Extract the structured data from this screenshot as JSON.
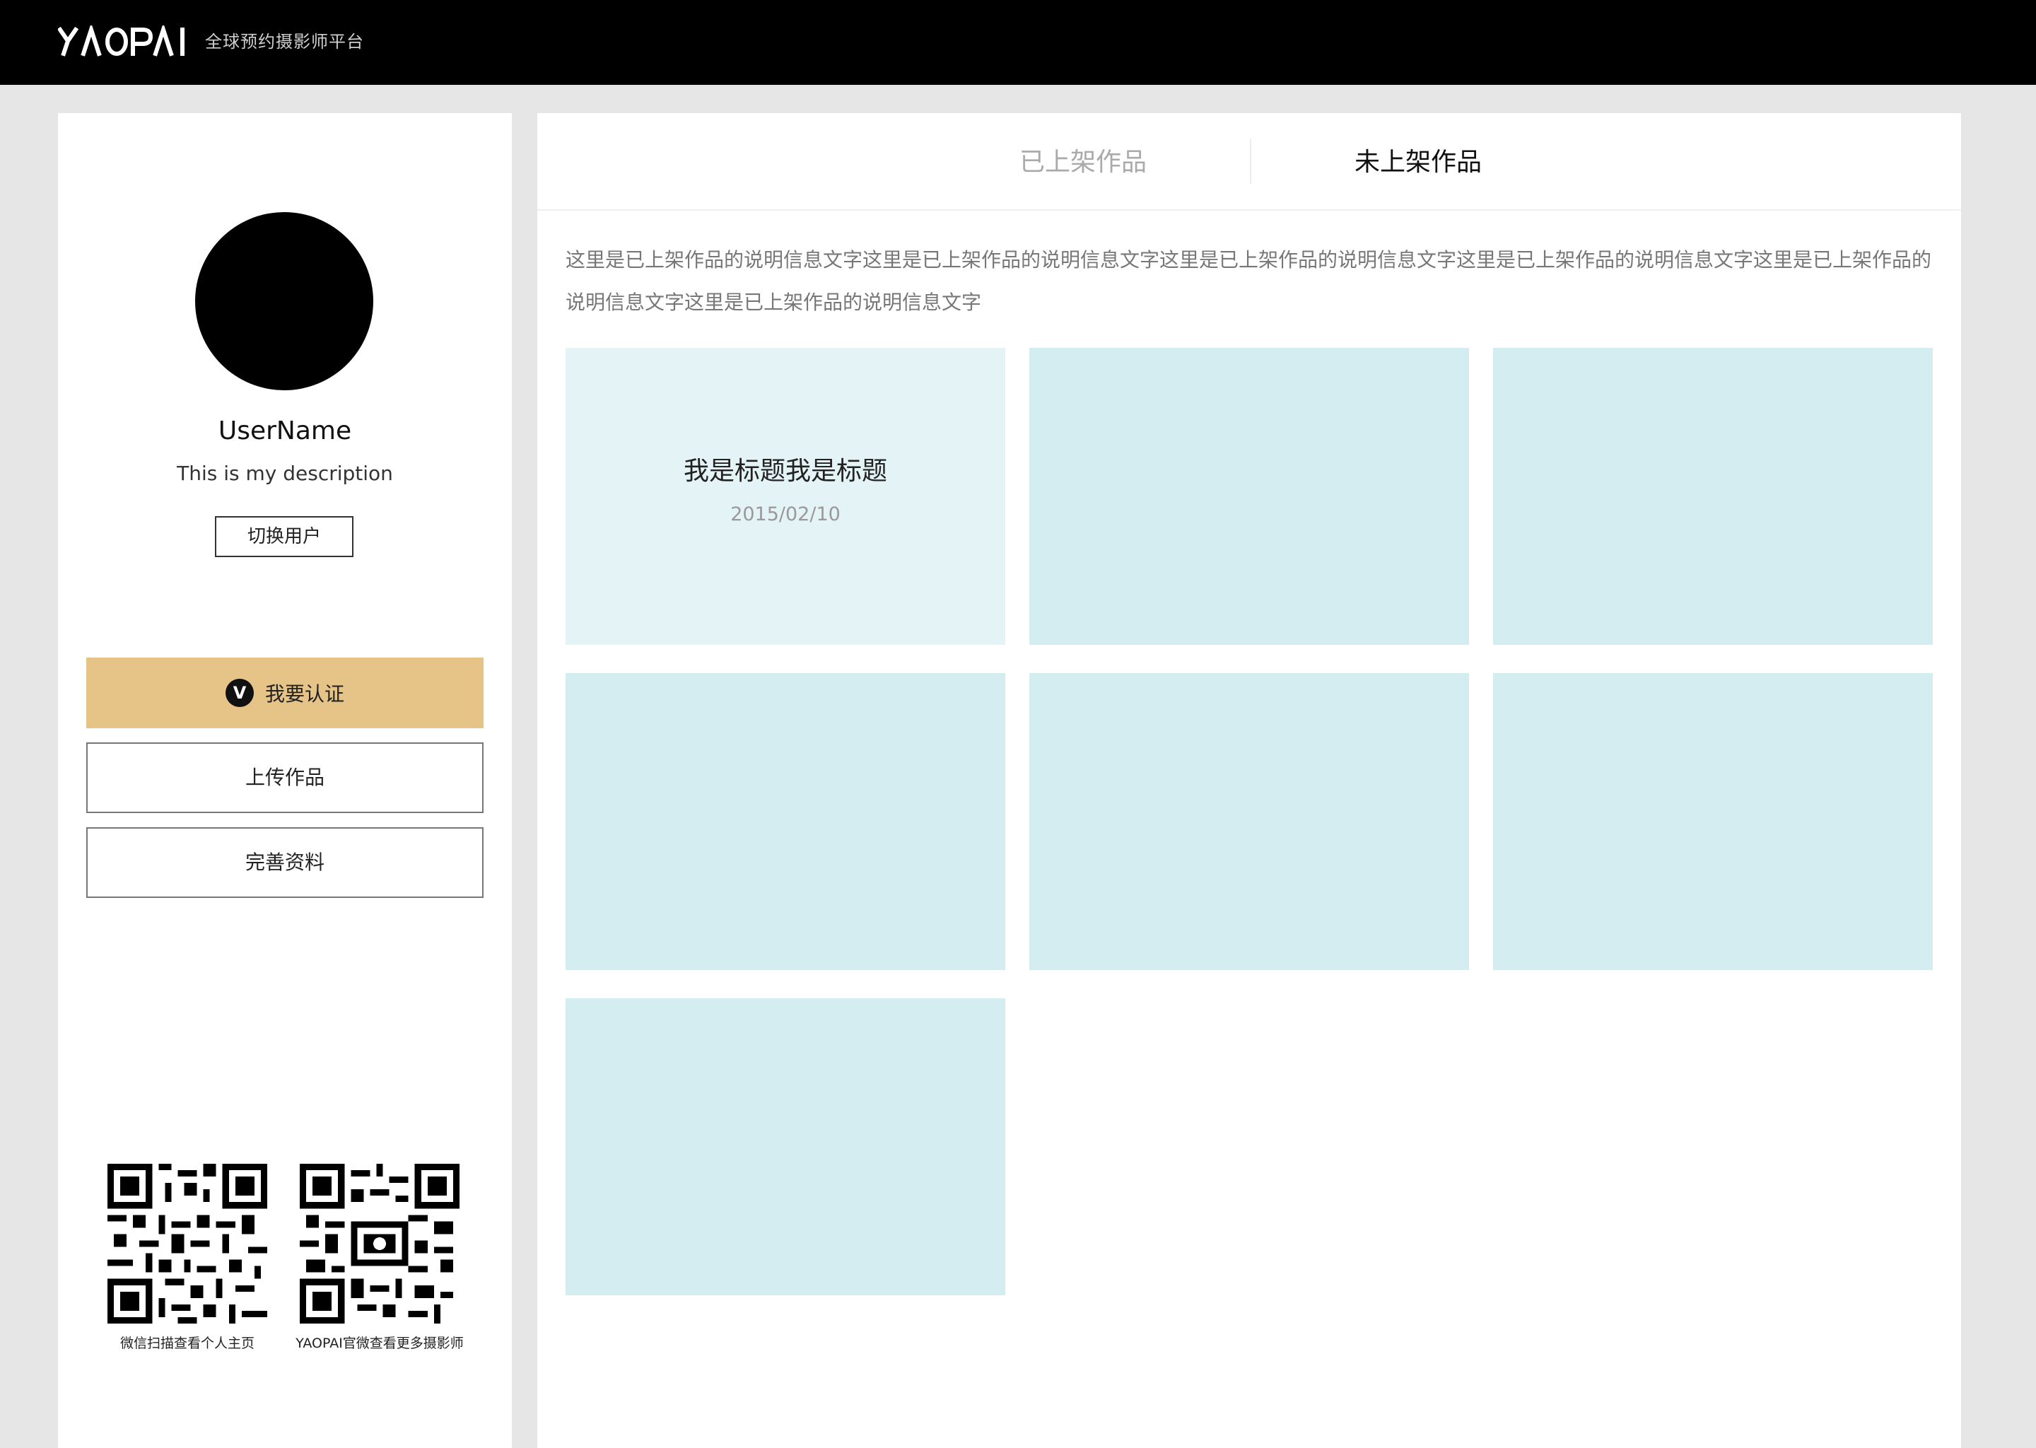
{
  "header": {
    "logo_text": "YAOPAI",
    "tagline": "全球预约摄影师平台"
  },
  "profile": {
    "username": "UserName",
    "description": "This is my description",
    "switch_user_label": "切换用户",
    "verify_label": "我要认证",
    "verify_badge": "V",
    "upload_label": "上传作品",
    "complete_profile_label": "完善资料",
    "qr_codes": [
      {
        "caption": "微信扫描查看个人主页"
      },
      {
        "caption": "YAOPAI官微查看更多摄影师"
      }
    ]
  },
  "main": {
    "tabs": [
      {
        "label": "已上架作品",
        "active": false
      },
      {
        "label": "未上架作品",
        "active": true
      }
    ],
    "info_text": "这里是已上架作品的说明信息文字这里是已上架作品的说明信息文字这里是已上架作品的说明信息文字这里是已上架作品的说明信息文字这里是已上架作品的说明信息文字这里是已上架作品的说明信息文字",
    "works": [
      {
        "title": "我是标题我是标题",
        "date": "2015/02/10"
      },
      {
        "title": "",
        "date": ""
      },
      {
        "title": "",
        "date": ""
      },
      {
        "title": "",
        "date": ""
      },
      {
        "title": "",
        "date": ""
      },
      {
        "title": "",
        "date": ""
      },
      {
        "title": "",
        "date": ""
      }
    ]
  },
  "colors": {
    "topbar": "#000000",
    "page_bg": "#e6e6e6",
    "verify_gold": "#e6c386",
    "card_bg": "#d4edf0",
    "card_featured_bg": "#e3f3f6"
  }
}
